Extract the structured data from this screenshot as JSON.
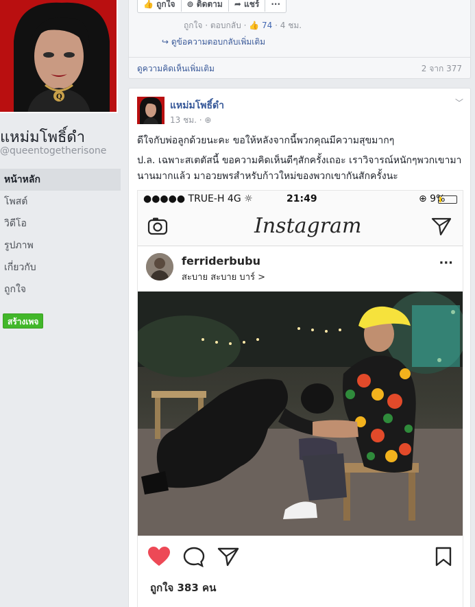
{
  "page": {
    "name": "แหม่มโพธิ์ดำ",
    "handle": "@queentogetherisone",
    "create_page": "สร้างเพจ"
  },
  "nav": {
    "items": [
      {
        "label": "หน้าหลัก",
        "active": true
      },
      {
        "label": "โพสต์"
      },
      {
        "label": "วิดีโอ"
      },
      {
        "label": "รูปภาพ"
      },
      {
        "label": "เกี่ยวกับ"
      },
      {
        "label": "ถูกใจ"
      }
    ]
  },
  "top_card": {
    "actions": {
      "like": "ถูกใจ",
      "follow": "ติดตาม",
      "share": "แชร์",
      "more": "···"
    },
    "comment_meta": {
      "like": "ถูกใจ",
      "reply": "ตอบกลับ",
      "like_count": "74",
      "time": "4 ชม."
    },
    "view_replies": "ดูข้อความตอบกลับเพิ่มเติม",
    "more_comments": "ดูความคิดเห็นเพิ่มเติม",
    "comment_count": "2 จาก 377"
  },
  "post": {
    "author": "แหม่มโพธิ์ดำ",
    "time": "13 ชม.",
    "text1": "ดีใจกับพ่อลูกด้วยนะคะ ขอให้หลังจากนี้พวกคุณมีความสุขมากๆ",
    "text2": "ป.ล. เฉพาะสเตตัสนี้ ขอความคิดเห็นดีๆสักครั้งเถอะ เราวิจารณ์หนักๆพวกเขามานานมากแล้ว มาอวยพรสำหรับก้าวใหม่ของพวกเขากันสักครั้งนะ"
  },
  "instagram": {
    "carrier": "●●●●● TRUE-H  4G ☼",
    "time": "21:49",
    "battery_text": "⊕ 9%",
    "battery_level": 0.09,
    "logo": "Instagram",
    "username": "ferriderbubu",
    "location": "สะบาย สะบาย บาร์ >",
    "more": "···",
    "likes": "ถูกใจ 383 คน",
    "colors": {
      "heart": "#ed4956",
      "battery": "#f4c400"
    }
  }
}
